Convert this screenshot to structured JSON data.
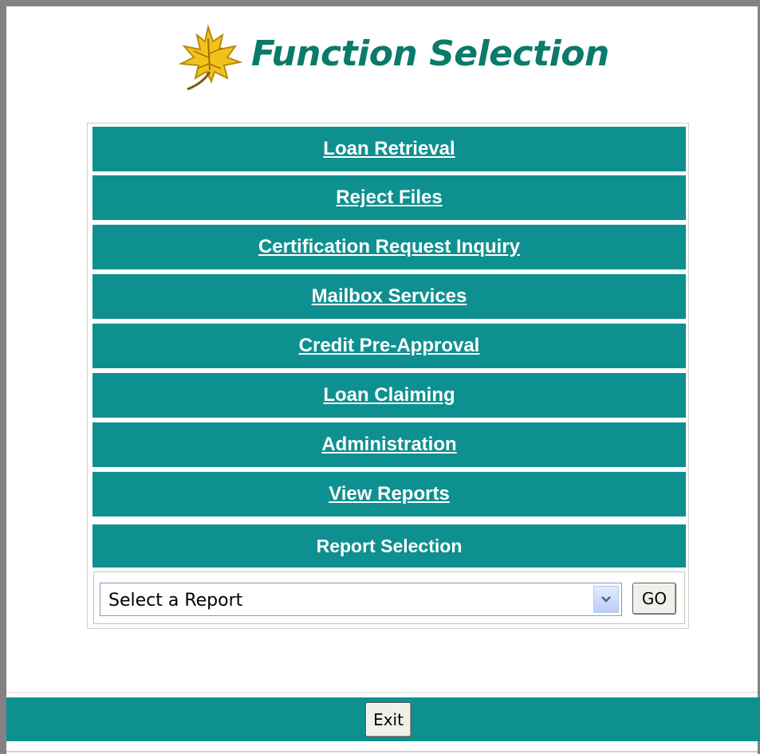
{
  "header": {
    "title": "Function Selection",
    "logo_icon": "maple-leaf-icon"
  },
  "menu": {
    "items": [
      {
        "label": "Loan Retrieval"
      },
      {
        "label": "Reject Files"
      },
      {
        "label": "Certification Request Inquiry"
      },
      {
        "label": "Mailbox Services"
      },
      {
        "label": "Credit Pre-Approval"
      },
      {
        "label": "Loan Claiming"
      },
      {
        "label": "Administration"
      },
      {
        "label": "View Reports"
      }
    ]
  },
  "report": {
    "title": "Report Selection",
    "select_value": "Select a Report",
    "go_label": "GO"
  },
  "footer": {
    "exit_label": "Exit"
  },
  "colors": {
    "teal": "#0f9090",
    "title_green": "#0a7a6a"
  }
}
